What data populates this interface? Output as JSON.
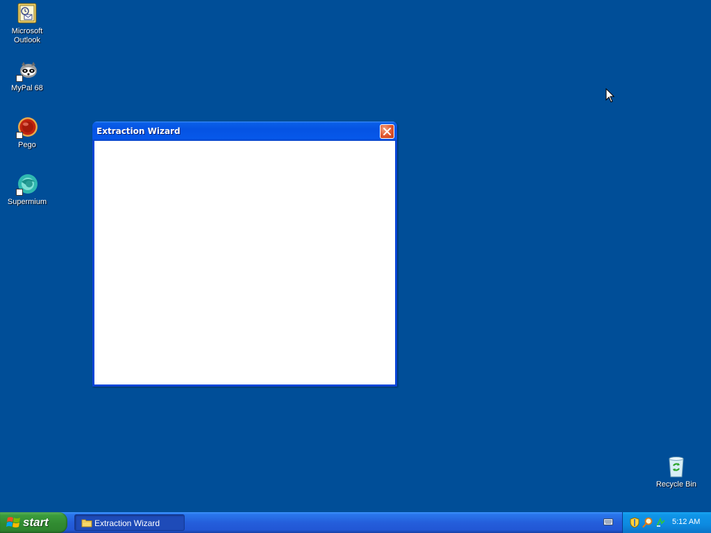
{
  "desktop": {
    "background": "#004e98",
    "icons": [
      {
        "label": "Microsoft Outlook",
        "line1": "Microsoft",
        "line2": "Outlook",
        "icon": "outlook-icon"
      },
      {
        "label": "MyPal 68",
        "icon": "mypal-icon"
      },
      {
        "label": "Pego",
        "icon": "pego-icon"
      },
      {
        "label": "Supermium",
        "icon": "supermium-icon"
      },
      {
        "label": "Recycle Bin",
        "icon": "recycle-bin-icon"
      }
    ]
  },
  "window": {
    "title": "Extraction Wizard",
    "close_icon": "close-icon",
    "titlebar_color": "#0553e3",
    "content_color": "#ffffff"
  },
  "taskbar": {
    "start_label": "start",
    "start_color": "#318b31",
    "tasks": [
      {
        "label": "Extraction Wizard",
        "icon": "folder-icon"
      }
    ],
    "tray": {
      "icons": [
        "security-shield-icon",
        "search-icon",
        "network-icon"
      ],
      "clock": "5:12 AM"
    },
    "keyboard_icon": "keyboard-icon"
  }
}
